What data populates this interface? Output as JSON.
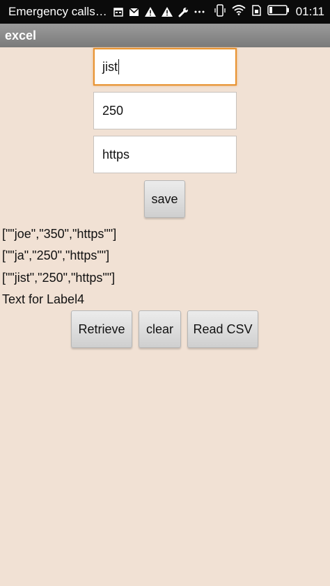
{
  "status_bar": {
    "notification_text": "Emergency calls…",
    "time": "01:11",
    "icons": [
      "calendar-icon",
      "gmail-icon",
      "warning-icon",
      "warning-icon",
      "wrench-icon",
      "more-icon",
      "vibrate-icon",
      "wifi-icon",
      "sim-icon",
      "battery-icon"
    ]
  },
  "app": {
    "title": "excel"
  },
  "form": {
    "field1_value": "jist",
    "field2_value": "250",
    "field3_value": "https",
    "save_label": "save"
  },
  "labels": {
    "label1": "[\"\"joe\",\"350\",\"https\"\"]",
    "label2": "[\"\"ja\",\"250\",\"https\"\"]",
    "label3": "[\"\"jist\",\"250\",\"https\"\"]",
    "label4": "Text for Label4"
  },
  "buttons": {
    "retrieve_label": "Retrieve",
    "clear_label": "clear",
    "read_csv_label": "Read CSV"
  }
}
